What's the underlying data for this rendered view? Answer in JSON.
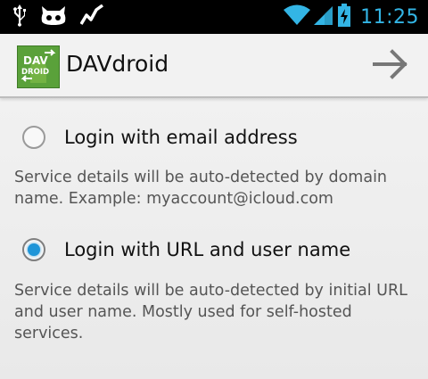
{
  "status_bar": {
    "left_icons": [
      "usb-icon",
      "android-debug-icon",
      "activity-graph-icon"
    ],
    "right_icons": [
      "wifi-icon",
      "cell-signal-icon",
      "battery-charging-icon"
    ],
    "time": "11:25",
    "accent_color": "#33b5e5"
  },
  "action_bar": {
    "app_logo_text_top": "DAV",
    "app_logo_text_bottom": "DROID",
    "title": "DAVdroid",
    "next_icon": "arrow-right-icon"
  },
  "login_options": [
    {
      "label": "Login with email address",
      "checked": false,
      "description": "Service details will be auto-detected by domain name. Example: myaccount@icloud.com"
    },
    {
      "label": "Login with URL and user name",
      "checked": true,
      "description": "Service details will be auto-detected by initial URL and user name. Mostly used for self-hosted services."
    }
  ]
}
